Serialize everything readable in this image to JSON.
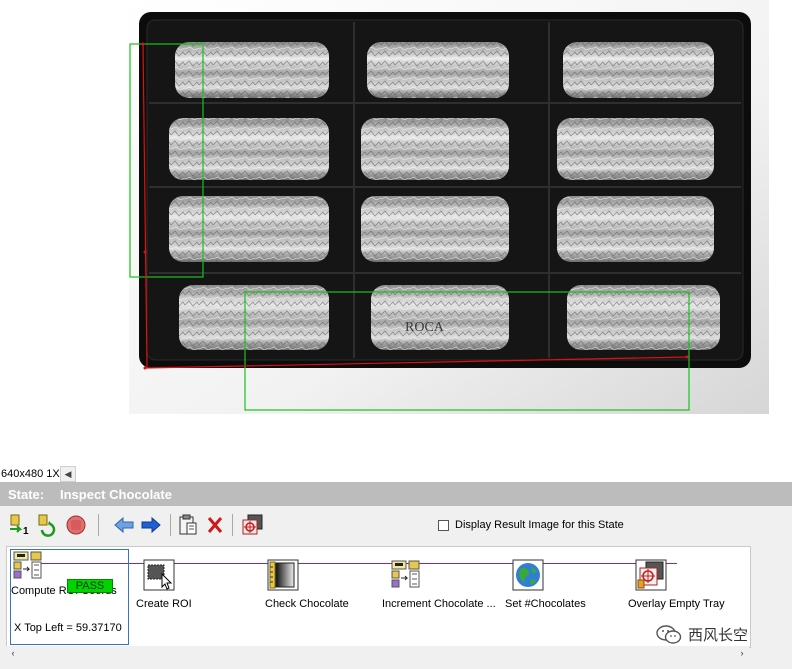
{
  "image_view": {
    "zoom_text": "640x480 1X",
    "scroll_left_icon": "triangle-left-icon",
    "tray_colors": {
      "tray": "#0a0a0a",
      "foil": "#bdbdbd",
      "roi_box": "#18c418",
      "edge_line": "#e01010"
    },
    "tray_text": "ROCA"
  },
  "state": {
    "label": "State:",
    "name": "Inspect Chocolate"
  },
  "toolbar": {
    "buttons": [
      "add-step-icon",
      "run-loop-icon",
      "stop-icon",
      "back-arrow-icon",
      "forward-arrow-icon",
      "clipboard-icon",
      "delete-icon",
      "overlay-icon"
    ],
    "display_result_label": "Display Result Image for this State"
  },
  "steps": [
    {
      "label": "Compute ROI Coords",
      "value": "X Top Left = 59.37170",
      "badge": "PASS",
      "icon": "calculator-icon"
    },
    {
      "label": "Create ROI",
      "icon": "roi-cursor-icon"
    },
    {
      "label": "Check Chocolate",
      "icon": "ruler-gradient-icon"
    },
    {
      "label": "Increment Chocolate ...",
      "icon": "calculator-icon"
    },
    {
      "label": "Set #Chocolates",
      "icon": "globe-icon"
    },
    {
      "label": "Overlay Empty Tray",
      "icon": "overlay-target-icon"
    }
  ],
  "watermark": {
    "text": "西风长空",
    "icon": "wechat-icon"
  }
}
